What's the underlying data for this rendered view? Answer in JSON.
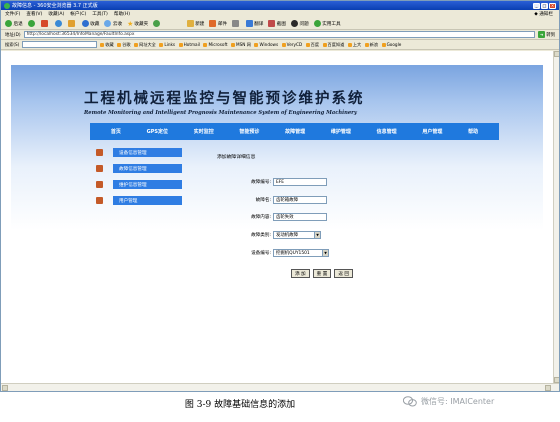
{
  "window": {
    "title": "故障信息 - 360安全浏览器 3.7 正式版",
    "controls": [
      "_",
      "□",
      "×"
    ]
  },
  "menu": {
    "items": [
      "文件(F)",
      "查看(V)",
      "收藏(A)",
      "帐户(C)",
      "工具(T)",
      "帮助(H)"
    ],
    "right_label": "◆ 通知栏"
  },
  "toolbar": {
    "back": "后退",
    "favorites": "收藏",
    "cloud": "云收",
    "collect": "收藏夹",
    "new_tab": "新建",
    "mail": "邮件",
    "translate": "翻译",
    "screenshot": "截图",
    "qq": "问题",
    "practical": "实用工具"
  },
  "address": {
    "label": "地址(D)",
    "url": "http://localhost:36534/InfoManage/FaultInfo.aspx",
    "go_label": "转到"
  },
  "favbar": {
    "label": "搜索(S)",
    "items": [
      "收藏",
      "谷歌",
      "网址大全",
      "Links",
      "Hotmail",
      "Microsoft",
      "MSN 网",
      "Windows",
      "VeryCD",
      "百度",
      "百度知道",
      "上大",
      "新浪",
      "Google"
    ]
  },
  "page": {
    "title": "工程机械远程监控与智能预诊维护系统",
    "subtitle": "Remote Monitoring and Intelligent Prognosis Maintenance System of Engineering Machinery"
  },
  "nav": [
    "首页",
    "GPS定位",
    "实时监控",
    "智能预诊",
    "故障管理",
    "维护管理",
    "信息管理",
    "用户管理",
    "帮助"
  ],
  "sidebar": [
    "设备信息管理",
    "故障信息管理",
    "维护信息管理",
    "用户管理"
  ],
  "form": {
    "title": "添加故障详细信息",
    "fault_id_label": "故障编号:",
    "fault_id_value": "EFE",
    "fault_name_label": "故障名:",
    "fault_name_value": "齿轮箱故障",
    "fault_content_label": "故障内容:",
    "fault_content_value": "齿轮失效",
    "fault_type_label": "故障类别:",
    "fault_type_value": "发动机故障",
    "device_id_label": "设备编号:",
    "device_id_value": "挖掘机QUY1501"
  },
  "actions": {
    "add": "添 加",
    "reset": "重 置",
    "back": "返 回"
  },
  "caption": "图 3-9  故障基础信息的添加",
  "watermark": "微信号: IMAICenter"
}
